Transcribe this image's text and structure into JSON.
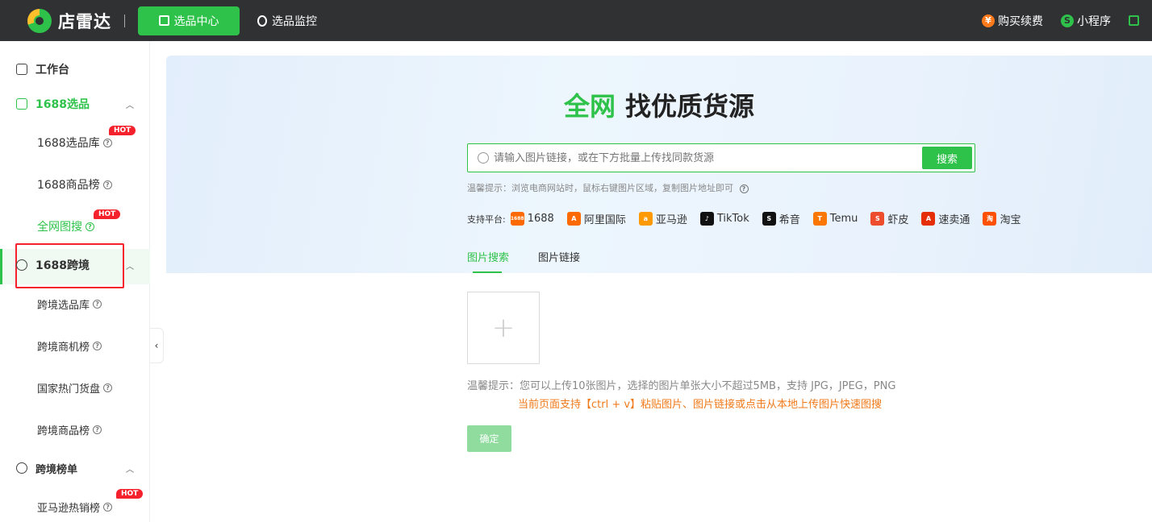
{
  "topbar": {
    "logo_text": "店雷达",
    "nav": [
      {
        "label": "选品中心",
        "active": true
      },
      {
        "label": "选品监控",
        "active": false
      }
    ],
    "buy_label": "购买续费",
    "buy_icon": "¥",
    "mini_label": "小程序"
  },
  "sidebar": {
    "workbench": "工作台",
    "group_1688": "1688选品",
    "item_1688_lib": "1688选品库",
    "item_1688_rank": "1688商品榜",
    "item_image_search": "全网图搜",
    "group_cross": "1688跨境",
    "item_cross_lib": "跨境选品库",
    "item_cross_opp": "跨境商机榜",
    "item_country_hot": "国家热门货盘",
    "item_cross_rank": "跨境商品榜",
    "group_cross_rank": "跨境榜单",
    "item_amazon_hot": "亚马逊热销榜",
    "hot_badge": "HOT",
    "help_icon": "?"
  },
  "hero": {
    "title_green": "全网",
    "title_rest": "找优质货源",
    "search_placeholder": "请输入图片链接，或在下方批量上传找同款货源",
    "search_button": "搜索",
    "tip": "温馨提示：浏览电商网站时，鼠标右键图片区域，复制图片地址即可",
    "platforms_label": "支持平台:",
    "platforms": [
      {
        "name": "1688",
        "color": "#ff6a00",
        "glyph": "1688"
      },
      {
        "name": "阿里国际",
        "color": "#ff6a00",
        "glyph": "A"
      },
      {
        "name": "亚马逊",
        "color": "#ff9900",
        "glyph": "a"
      },
      {
        "name": "TikTok",
        "color": "#111111",
        "glyph": "♪"
      },
      {
        "name": "希音",
        "color": "#111111",
        "glyph": "S"
      },
      {
        "name": "Temu",
        "color": "#fb7701",
        "glyph": "T"
      },
      {
        "name": "虾皮",
        "color": "#ee4d2d",
        "glyph": "S"
      },
      {
        "name": "速卖通",
        "color": "#e62e04",
        "glyph": "A"
      },
      {
        "name": "淘宝",
        "color": "#ff5000",
        "glyph": "淘"
      }
    ]
  },
  "tabs": [
    {
      "label": "图片搜索",
      "active": true
    },
    {
      "label": "图片链接",
      "active": false
    }
  ],
  "upload": {
    "plus": "+",
    "hint1": "温馨提示：您可以上传10张图片，选择的图片单张大小不超过5MB，支持 JPG，JPEG，PNG",
    "hint2": "当前页面支持【ctrl + v】粘贴图片、图片链接或点击从本地上传图片快速图搜",
    "confirm": "确定"
  },
  "colors": {
    "brand_green": "#2ec24a",
    "topbar_bg": "#2f3133",
    "hot_red": "#f5222d",
    "warn_orange": "#f07a1a"
  }
}
